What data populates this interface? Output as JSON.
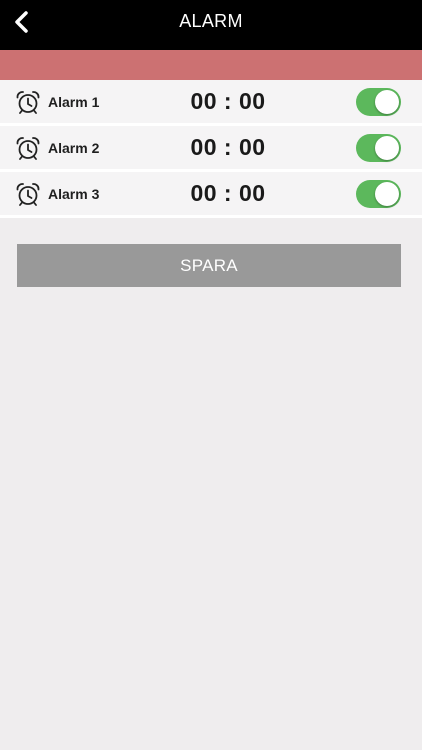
{
  "header": {
    "title": "ALARM",
    "back_icon": "chevron-left-icon"
  },
  "colors": {
    "header_bg": "#000000",
    "banner": "#cc7172",
    "toggle_on": "#5cb85c",
    "save_button_bg": "#999999",
    "page_bg": "#efedee"
  },
  "alarms": [
    {
      "label": "Alarm 1",
      "time": "00 : 00",
      "enabled": true,
      "icon": "alarm-clock-icon"
    },
    {
      "label": "Alarm 2",
      "time": "00 : 00",
      "enabled": true,
      "icon": "alarm-clock-icon"
    },
    {
      "label": "Alarm 3",
      "time": "00 : 00",
      "enabled": true,
      "icon": "alarm-clock-icon"
    }
  ],
  "save_button": {
    "label": "SPARA"
  }
}
